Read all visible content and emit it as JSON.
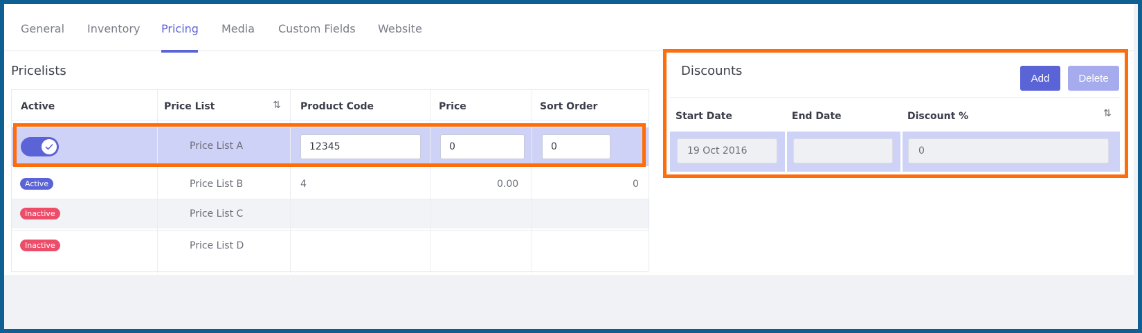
{
  "tabs": [
    {
      "label": "General",
      "active": false
    },
    {
      "label": "Inventory",
      "active": false
    },
    {
      "label": "Pricing",
      "active": true
    },
    {
      "label": "Media",
      "active": false
    },
    {
      "label": "Custom Fields",
      "active": false
    },
    {
      "label": "Website",
      "active": false
    }
  ],
  "pricelists": {
    "title": "Pricelists",
    "columns": [
      "Active",
      "Price List",
      "Product Code",
      "Price",
      "Sort Order"
    ],
    "rows": [
      {
        "active_toggle": true,
        "price_list": "Price List A",
        "product_code": "12345",
        "price": "0",
        "sort_order": "0"
      },
      {
        "status": "Active",
        "price_list": "Price List B",
        "product_code": "4",
        "price": "0.00",
        "sort_order": "0"
      },
      {
        "status": "Inactive",
        "price_list": "Price List C",
        "product_code": "",
        "price": "",
        "sort_order": ""
      },
      {
        "status": "Inactive",
        "price_list": "Price List D",
        "product_code": "",
        "price": "",
        "sort_order": ""
      }
    ]
  },
  "discounts": {
    "title": "Discounts",
    "add_label": "Add",
    "delete_label": "Delete",
    "columns": [
      "Start Date",
      "End Date",
      "Discount %"
    ],
    "row": {
      "start_date": "19 Oct 2016",
      "end_date": "",
      "discount": "0"
    }
  },
  "colors": {
    "accent": "#5b64d6",
    "selected_row": "#cfd2f7",
    "inactive_badge": "#ee4d6a",
    "highlight": "#ff6d0a",
    "frame": "#0f5f93"
  },
  "icons": {
    "sort": "sort-arrows-icon",
    "check": "check-icon"
  }
}
